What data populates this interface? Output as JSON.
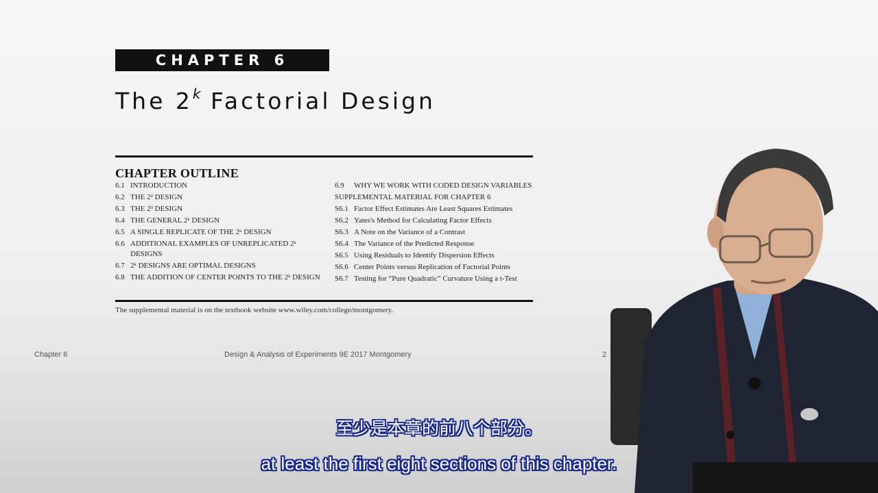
{
  "slide": {
    "chapter_label": "CHAPTER 6",
    "title_main": "The 2",
    "title_sup": "k",
    "title_rest": " Factorial Design",
    "outline_heading": "CHAPTER OUTLINE",
    "outline_left": [
      {
        "num": "6.1",
        "text": "INTRODUCTION"
      },
      {
        "num": "6.2",
        "text": "THE 2² DESIGN"
      },
      {
        "num": "6.3",
        "text": "THE 2³ DESIGN"
      },
      {
        "num": "6.4",
        "text": "THE GENERAL 2ᵏ DESIGN"
      },
      {
        "num": "6.5",
        "text": "A SINGLE REPLICATE OF THE 2ᵏ DESIGN"
      },
      {
        "num": "6.6",
        "text": "ADDITIONAL EXAMPLES OF UNREPLICATED 2ᵏ DESIGNS"
      },
      {
        "num": "6.7",
        "text": "2ᵏ DESIGNS ARE OPTIMAL DESIGNS"
      },
      {
        "num": "6.8",
        "text": "THE ADDITION OF CENTER POINTS TO THE 2ᵏ DESIGN"
      }
    ],
    "outline_right_first": {
      "num": "6.9",
      "text": "WHY WE WORK WITH CODED DESIGN VARIABLES"
    },
    "supplemental_heading": "SUPPLEMENTAL MATERIAL FOR CHAPTER 6",
    "outline_right": [
      {
        "num": "S6.1",
        "text": "Factor Effect Estimates Are Least Squares Estimates"
      },
      {
        "num": "S6.2",
        "text": "Yates's Method for Calculating Factor Effects"
      },
      {
        "num": "S6.3",
        "text": "A Note on the Variance of a Contrast"
      },
      {
        "num": "S6.4",
        "text": "The Variance of the Predicted Response"
      },
      {
        "num": "S6.5",
        "text": "Using Residuals to Identify Dispersion Effects"
      },
      {
        "num": "S6.6",
        "text": "Center Points versus Replication of Factorial Points"
      },
      {
        "num": "S6.7",
        "text": "Testing for “Pure Quadratic” Curvature Using a t-Test"
      }
    ],
    "footnote": "The supplemental material is on the textbook website www.wiley.com/college/montgomery.",
    "footer_left": "Chapter 6",
    "footer_center": "Design & Analysis of Experiments 9E 2017 Montgomery",
    "footer_page": "2"
  },
  "subtitles": {
    "zh": "至少是本章的前八个部分。",
    "en": "at least the first eight sections of this chapter."
  },
  "colors": {
    "subtitle_outline": "#1b2a8c",
    "sweater": "#1f2433",
    "shirt": "#8fb0d8"
  }
}
